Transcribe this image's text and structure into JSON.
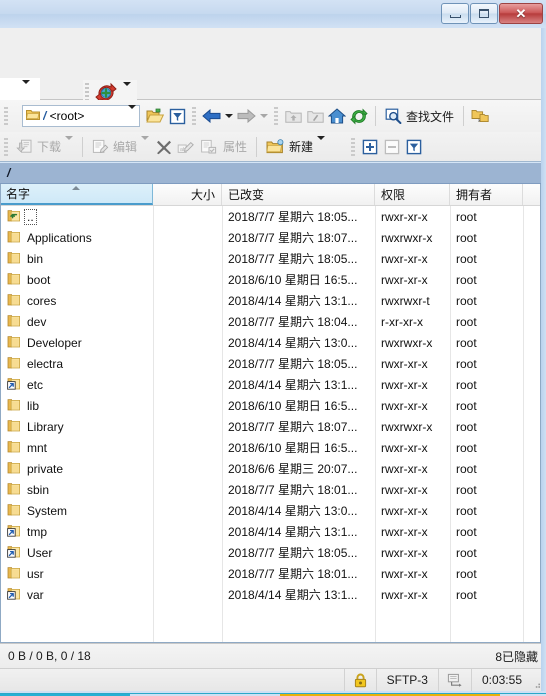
{
  "window": {
    "title": "",
    "buttons": {
      "minimize": "minimize-button",
      "restore": "restore-button",
      "close": "close-button"
    }
  },
  "upper_toolbar": {
    "combo_value": "",
    "sync_button_label": "transfer-queue"
  },
  "toolbar_path": {
    "path_value": "/ <root>",
    "path_prefix": "/",
    "path_suffix": " <root>",
    "open_dir_label": "open-directory",
    "filter_label": "filter",
    "back_label": "back",
    "forward_label": "forward",
    "up_label": "up-one-level",
    "root_label": "go-to-root",
    "home_label": "home",
    "refresh_label": "refresh",
    "find_files_label": "查找文件",
    "sync_browse_label": "synchronized-browsing"
  },
  "toolbar_actions": {
    "download_label": "下载",
    "edit_label": "编辑",
    "delete_label": "delete",
    "rename_label": "rename",
    "duplicate_label": "duplicate",
    "properties_label": "属性",
    "new_label": "新建",
    "expand_label": "expand-all",
    "collapse_label": "collapse-all",
    "filter_list_label": "filter-list"
  },
  "path_bar": {
    "current_path": "/"
  },
  "list": {
    "columns": [
      {
        "key": "name",
        "label": "名字",
        "align": "left",
        "sorted": true,
        "sort_dir": "asc"
      },
      {
        "key": "size",
        "label": "大小",
        "align": "right",
        "sorted": false
      },
      {
        "key": "changed",
        "label": "已改变",
        "align": "left",
        "sorted": false
      },
      {
        "key": "perms",
        "label": "权限",
        "align": "left",
        "sorted": false
      },
      {
        "key": "owner",
        "label": "拥有者",
        "align": "left",
        "sorted": false
      }
    ],
    "rows": [
      {
        "name": "..",
        "icon": "parent-folder-icon",
        "size": "",
        "changed": "2018/7/7 星期六 18:05...",
        "perms": "rwxr-xr-x",
        "owner": "root"
      },
      {
        "name": "Applications",
        "icon": "folder-icon",
        "size": "",
        "changed": "2018/7/7 星期六 18:07...",
        "perms": "rwxrwxr-x",
        "owner": "root"
      },
      {
        "name": "bin",
        "icon": "folder-icon",
        "size": "",
        "changed": "2018/7/7 星期六 18:05...",
        "perms": "rwxr-xr-x",
        "owner": "root"
      },
      {
        "name": "boot",
        "icon": "folder-icon",
        "size": "",
        "changed": "2018/6/10 星期日 16:5...",
        "perms": "rwxr-xr-x",
        "owner": "root"
      },
      {
        "name": "cores",
        "icon": "folder-icon",
        "size": "",
        "changed": "2018/4/14 星期六 13:1...",
        "perms": "rwxrwxr-t",
        "owner": "root"
      },
      {
        "name": "dev",
        "icon": "folder-icon",
        "size": "",
        "changed": "2018/7/7 星期六 18:04...",
        "perms": "r-xr-xr-x",
        "owner": "root"
      },
      {
        "name": "Developer",
        "icon": "folder-icon",
        "size": "",
        "changed": "2018/4/14 星期六 13:0...",
        "perms": "rwxrwxr-x",
        "owner": "root"
      },
      {
        "name": "electra",
        "icon": "folder-icon",
        "size": "",
        "changed": "2018/7/7 星期六 18:05...",
        "perms": "rwxr-xr-x",
        "owner": "root"
      },
      {
        "name": "etc",
        "icon": "symlink-folder-icon",
        "size": "",
        "changed": "2018/4/14 星期六 13:1...",
        "perms": "rwxr-xr-x",
        "owner": "root"
      },
      {
        "name": "lib",
        "icon": "folder-icon",
        "size": "",
        "changed": "2018/6/10 星期日 16:5...",
        "perms": "rwxr-xr-x",
        "owner": "root"
      },
      {
        "name": "Library",
        "icon": "folder-icon",
        "size": "",
        "changed": "2018/7/7 星期六 18:07...",
        "perms": "rwxrwxr-x",
        "owner": "root"
      },
      {
        "name": "mnt",
        "icon": "folder-icon",
        "size": "",
        "changed": "2018/6/10 星期日 16:5...",
        "perms": "rwxr-xr-x",
        "owner": "root"
      },
      {
        "name": "private",
        "icon": "folder-icon",
        "size": "",
        "changed": "2018/6/6 星期三 20:07...",
        "perms": "rwxr-xr-x",
        "owner": "root"
      },
      {
        "name": "sbin",
        "icon": "folder-icon",
        "size": "",
        "changed": "2018/7/7 星期六 18:01...",
        "perms": "rwxr-xr-x",
        "owner": "root"
      },
      {
        "name": "System",
        "icon": "folder-icon",
        "size": "",
        "changed": "2018/4/14 星期六 13:0...",
        "perms": "rwxr-xr-x",
        "owner": "root"
      },
      {
        "name": "tmp",
        "icon": "symlink-folder-icon",
        "size": "",
        "changed": "2018/4/14 星期六 13:1...",
        "perms": "rwxr-xr-x",
        "owner": "root"
      },
      {
        "name": "User",
        "icon": "symlink-folder-icon",
        "size": "",
        "changed": "2018/7/7 星期六 18:05...",
        "perms": "rwxr-xr-x",
        "owner": "root"
      },
      {
        "name": "usr",
        "icon": "folder-icon",
        "size": "",
        "changed": "2018/7/7 星期六 18:01...",
        "perms": "rwxr-xr-x",
        "owner": "root"
      },
      {
        "name": "var",
        "icon": "symlink-folder-icon",
        "size": "",
        "changed": "2018/4/14 星期六 13:1...",
        "perms": "rwxr-xr-x",
        "owner": "root"
      }
    ]
  },
  "status": {
    "selection_summary": "0 B / 0 B, 0 / 18",
    "hidden_summary": "8已隐藏",
    "lock_icon": "lock-icon",
    "protocol": "SFTP-3",
    "session_icon": "session-icon",
    "elapsed": "0:03:55"
  },
  "colors": {
    "accent": "#4a9ccc",
    "pathbar_bg": "#9cb4d2",
    "close_button": "#b73c3c",
    "folder": "#f3cd78",
    "link_blue": "#2a5fa8"
  }
}
